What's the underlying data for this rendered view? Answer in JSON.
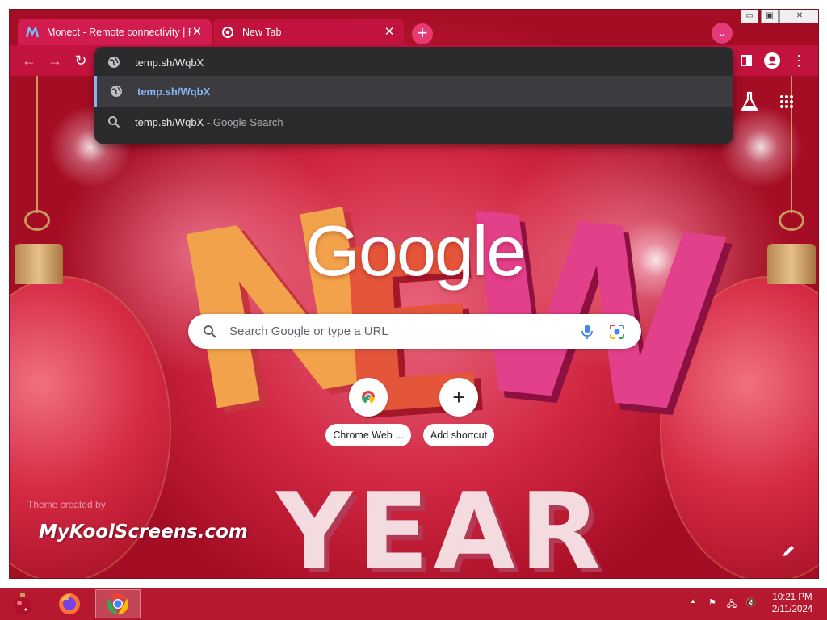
{
  "window": {
    "minimize_glyph": "▭",
    "maximize_glyph": "▣",
    "close_glyph": "✕"
  },
  "tabs": [
    {
      "title": "Monect - Remote connectivity | F",
      "close_glyph": "✕",
      "active": false
    },
    {
      "title": "New Tab",
      "close_glyph": "✕",
      "active": true
    }
  ],
  "tabstrip": {
    "new_tab_glyph": "+",
    "tab_search_glyph": "⌄"
  },
  "toolbar": {
    "back_glyph": "←",
    "forward_glyph": "→",
    "reload_glyph": "↻",
    "menu_glyph": "⋮"
  },
  "omnibox": {
    "input_value": "temp.sh/WqbX",
    "suggestions": [
      {
        "text": "temp.sh/WqbX",
        "suffix": "",
        "icon": "globe-icon"
      },
      {
        "text": "temp.sh/WqbX",
        "suffix": "- Google Search",
        "icon": "search-icon"
      }
    ]
  },
  "ntp": {
    "logo_text": "Google",
    "search_placeholder": "Search Google or type a URL",
    "shortcuts": [
      {
        "label": "Chrome Web ...",
        "icon": "chrome-web-store-icon"
      },
      {
        "label": "Add shortcut",
        "icon": "plus-icon",
        "glyph": "+"
      }
    ],
    "theme_credit": "Theme created by",
    "theme_brand": "MyKoolScreens.com",
    "decor_word_1": "NEW",
    "decor_word_2": "YEAR"
  },
  "taskbar": {
    "apps": [
      "ornament-start-icon",
      "firefox-icon",
      "chrome-icon"
    ],
    "tray_glyphs": {
      "chevron": "▲",
      "flag": "⚑",
      "network": "🖧",
      "volume": "🔇"
    },
    "time": "10:21 PM",
    "date": "2/11/2024"
  },
  "colors": {
    "toolbar": "#c1133e",
    "omnibox_bg": "#2b2b2e",
    "suggestion_highlight": "#8ab4f8",
    "taskbar": "#b5182f"
  }
}
